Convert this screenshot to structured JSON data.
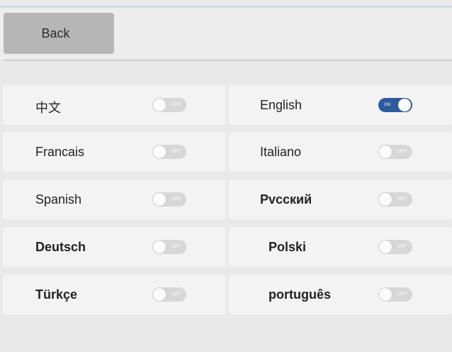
{
  "header": {
    "back_label": "Back"
  },
  "languages": [
    {
      "label": "中文",
      "toggle_text": "OFF",
      "state": "off"
    },
    {
      "label": "English",
      "toggle_text": "ON",
      "state": "on"
    },
    {
      "label": "Francais",
      "toggle_text": "OFF",
      "state": "off"
    },
    {
      "label": "Italiano",
      "toggle_text": "OFF",
      "state": "off"
    },
    {
      "label": "Spanish",
      "toggle_text": "OFF",
      "state": "off"
    },
    {
      "label": "Pvсский",
      "toggle_text": "OFF",
      "state": "off"
    },
    {
      "label": "Deutsch",
      "toggle_text": "OFF",
      "state": "off"
    },
    {
      "label": "Polski",
      "toggle_text": "OFF",
      "state": "off"
    },
    {
      "label": "Türkçe",
      "toggle_text": "OFF",
      "state": "off"
    },
    {
      "label": "português",
      "toggle_text": "OFF",
      "state": "off"
    }
  ],
  "colors": {
    "toggle_on": "#2c5a9c",
    "toggle_off": "#d7d7d7",
    "back_button": "#b6b6b6"
  }
}
